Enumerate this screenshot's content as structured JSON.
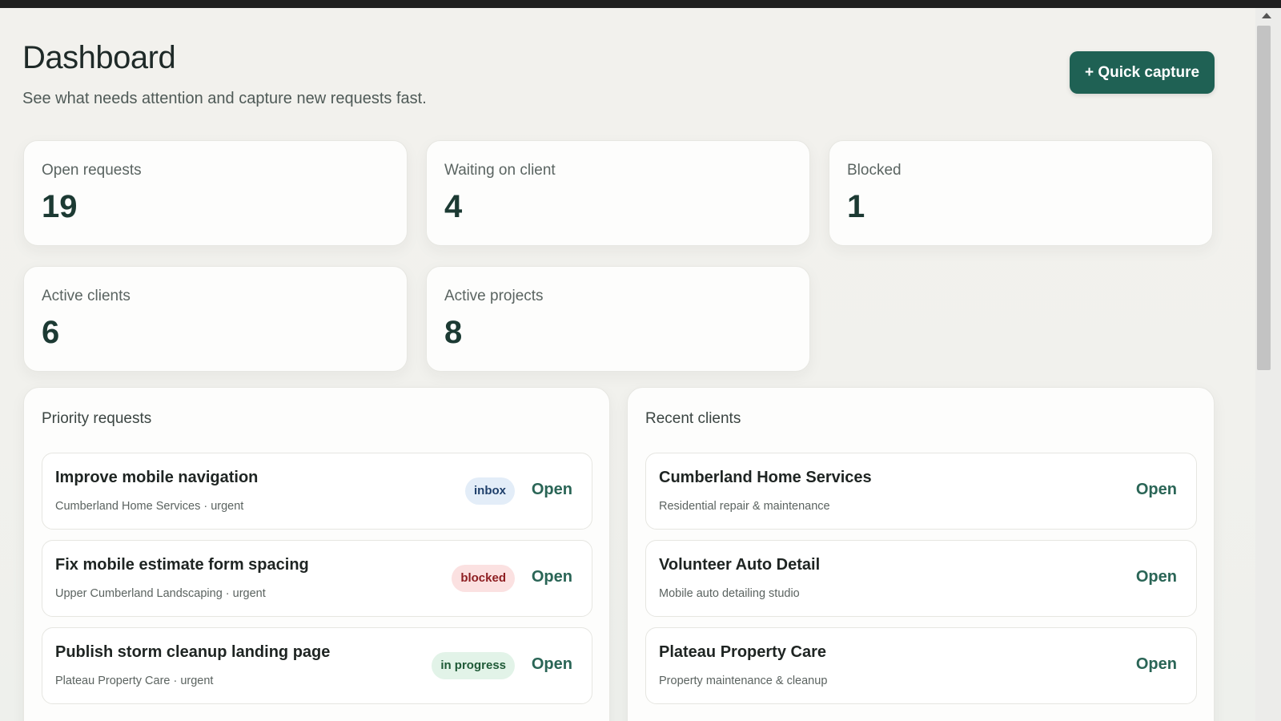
{
  "header": {
    "title": "Dashboard",
    "subtitle": "See what needs attention and capture new requests fast.",
    "quick_capture_label": "+ Quick capture"
  },
  "stats": [
    {
      "label": "Open requests",
      "value": "19"
    },
    {
      "label": "Waiting on client",
      "value": "4"
    },
    {
      "label": "Blocked",
      "value": "1"
    },
    {
      "label": "Active clients",
      "value": "6"
    },
    {
      "label": "Active projects",
      "value": "8"
    }
  ],
  "priority_requests": {
    "title": "Priority requests",
    "items": [
      {
        "title": "Improve mobile navigation",
        "subtitle": "Cumberland Home Services · urgent",
        "status": "inbox",
        "action": "Open"
      },
      {
        "title": "Fix mobile estimate form spacing",
        "subtitle": "Upper Cumberland Landscaping · urgent",
        "status": "blocked",
        "action": "Open"
      },
      {
        "title": "Publish storm cleanup landing page",
        "subtitle": "Plateau Property Care · urgent",
        "status": "in progress",
        "action": "Open"
      }
    ]
  },
  "recent_clients": {
    "title": "Recent clients",
    "items": [
      {
        "name": "Cumberland Home Services",
        "description": "Residential repair & maintenance",
        "action": "Open"
      },
      {
        "name": "Volunteer Auto Detail",
        "description": "Mobile auto detailing studio",
        "action": "Open"
      },
      {
        "name": "Plateau Property Care",
        "description": "Property maintenance & cleanup",
        "action": "Open"
      }
    ]
  },
  "colors": {
    "accent": "#1f6154",
    "stat_value": "#1c3a33",
    "badge_inbox_bg": "#e3edf8",
    "badge_blocked_bg": "#fbe1e1",
    "badge_progress_bg": "#e2f3e8"
  }
}
